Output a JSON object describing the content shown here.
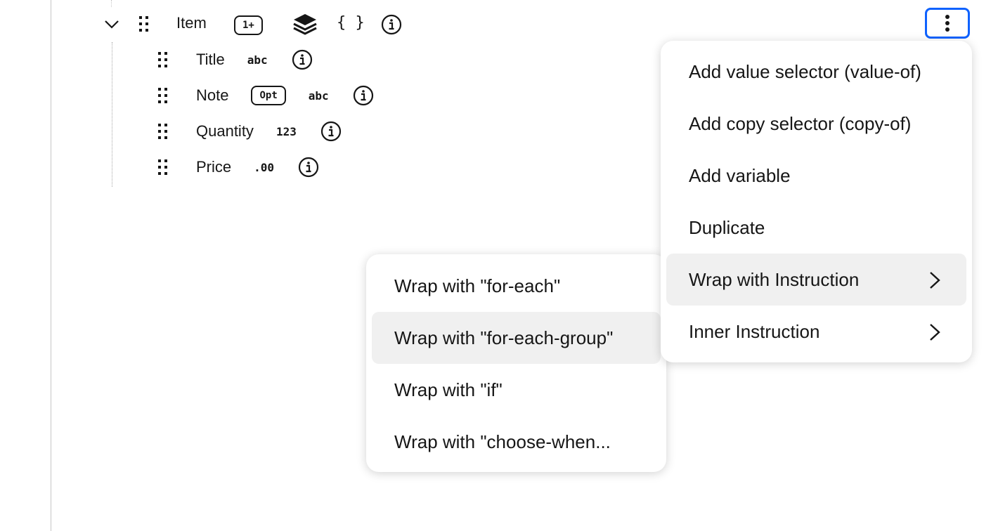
{
  "tree": {
    "parent": {
      "label": "Item",
      "cardinality_badge": "1+",
      "icons": [
        "chevron-down-icon",
        "drag-handle-icon",
        "layers-icon",
        "braces-icon",
        "info-icon"
      ],
      "braces": "{ }"
    },
    "children": [
      {
        "label": "Title",
        "badge": "",
        "type_glyph": "abc"
      },
      {
        "label": "Note",
        "badge": "Opt",
        "type_glyph": "abc"
      },
      {
        "label": "Quantity",
        "badge": "",
        "type_glyph": "123"
      },
      {
        "label": "Price",
        "badge": "",
        "type_glyph": ".00"
      }
    ]
  },
  "overflow_button": {
    "icon": "overflow-menu-vertical-icon"
  },
  "context_menu": {
    "items": [
      {
        "label": "Add value selector (value-of)"
      },
      {
        "label": "Add copy selector (copy-of)"
      },
      {
        "label": "Add variable"
      },
      {
        "label": "Duplicate"
      },
      {
        "label": "Wrap with Instruction",
        "has_submenu": true,
        "highlighted": true
      },
      {
        "label": "Inner Instruction",
        "has_submenu": true
      }
    ]
  },
  "submenu": {
    "items": [
      {
        "label": "Wrap with \"for-each\""
      },
      {
        "label": "Wrap with \"for-each-group\"",
        "highlighted": true
      },
      {
        "label": "Wrap with \"if\""
      },
      {
        "label": "Wrap with \"choose-when..."
      }
    ]
  },
  "colors": {
    "focus": "#0f62fe",
    "text": "#161616",
    "hover": "#f0f0f0"
  }
}
